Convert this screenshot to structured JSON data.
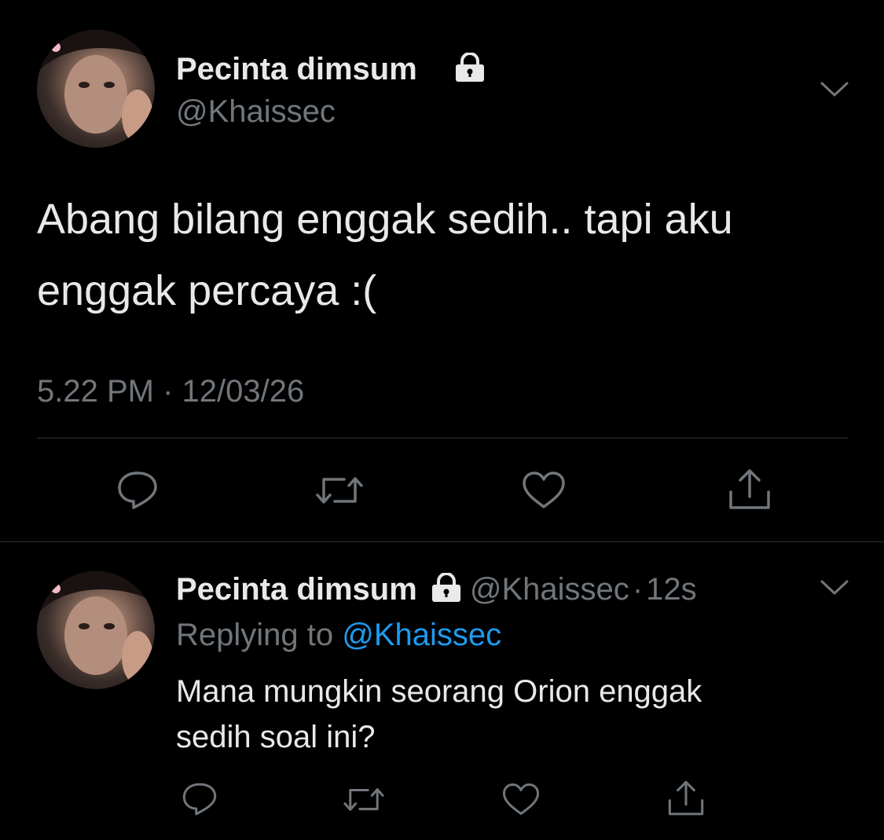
{
  "main_tweet": {
    "display_name": "Pecinta dimsum",
    "handle": "@Khaissec",
    "text_line1": "Abang bilang enggak sedih.. tapi aku",
    "text_line2": "enggak percaya :(",
    "timestamp": "5.22 PM · 12/03/26"
  },
  "reply_tweet": {
    "display_name": "Pecinta dimsum",
    "handle": "@Khaissec",
    "separator": "·",
    "age": "12s",
    "replying_prefix": "Replying to",
    "replying_handle": "@Khaissec",
    "text_line1": "Mana mungkin seorang Orion enggak",
    "text_line2": "sedih soal ini?"
  },
  "icons": [
    "lock-icon",
    "chevron-down-icon",
    "reply-icon",
    "retweet-icon",
    "like-icon",
    "share-icon"
  ],
  "colors": {
    "background": "#000000",
    "text": "#e7e9ea",
    "muted": "#71767b",
    "link": "#1d9bf0",
    "divider": "#2f3336"
  }
}
